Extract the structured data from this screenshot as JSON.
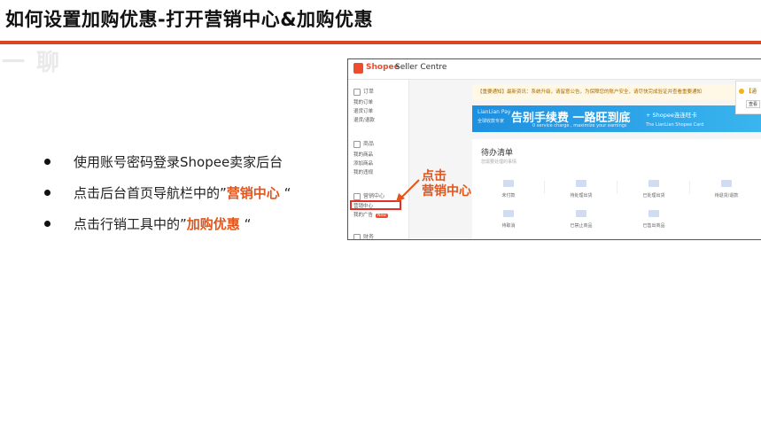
{
  "slide": {
    "title": "如何设置加购优惠-打开营销中心&加购优惠",
    "watermark": "一 聊"
  },
  "bullets": [
    {
      "pre": "使用账号密码登录Shopee卖家后台",
      "hl": "",
      "post": ""
    },
    {
      "pre": "点击后台首页导航栏中的”",
      "hl": "营销中心",
      "post": "“"
    },
    {
      "pre": "点击行销工具中的”",
      "hl": "加购优惠",
      "post": "“"
    }
  ],
  "screenshot": {
    "logo": "Shopee",
    "logo_sub": "Seller Centre",
    "sidebar": {
      "group_orders": "订单",
      "orders_items": [
        "我的订单",
        "退货订单",
        "退货/退款"
      ],
      "group_products": "商品",
      "product_items": [
        "我的商品",
        "添加商品",
        "我的违规"
      ],
      "group_marketing": "营销中心",
      "marketing_items": [
        "营销中心",
        "我的广告"
      ],
      "new_tag": "New",
      "group_finance": "财务"
    },
    "notice": "【重要通知】最新资讯：系统升级，请留意公告，为保障您的账户安全，请尽快完成验证并查看重要通知",
    "banner": {
      "brand_l1": "LianLian Pay",
      "brand_l2": "全球收款专家",
      "main": "告别手续费 一路旺到底",
      "sub": "0 service charge , maximize your earnings",
      "right_l1": "+ Shopee连连旺卡",
      "right_l2": "The LianLian Shopee Card"
    },
    "popup": {
      "title": "【通",
      "button": "查看"
    },
    "todo": {
      "title": "待办清单",
      "subtitle": "您需要处理的事情",
      "row1": [
        "未付款",
        "待处理出货",
        "已处理出货",
        "待退货/退款"
      ],
      "row2": [
        "待取消",
        "已禁止商品",
        "已售出商品"
      ]
    }
  },
  "callout": {
    "line1": "点击",
    "line2": "营销中心"
  },
  "colors": {
    "accent": "#e2551c",
    "rule": "#d9461f",
    "highlight_box": "#e0302a",
    "shopee": "#ee4d2d"
  }
}
